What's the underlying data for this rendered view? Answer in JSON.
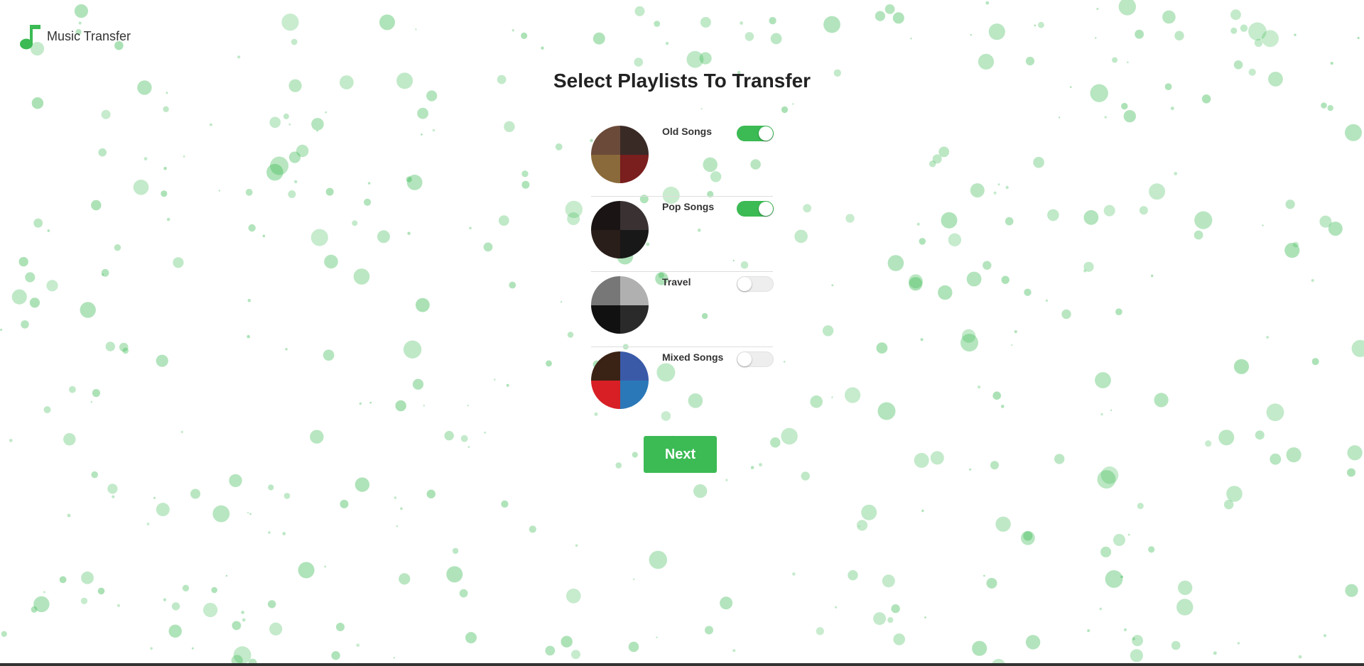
{
  "brand": {
    "name": "Music Transfer",
    "icon": "music-note-icon",
    "color": "#3cba54"
  },
  "page_title": "Select Playlists To Transfer",
  "playlists": [
    {
      "name": "Old Songs",
      "selected": true,
      "cover_colors": [
        "#6b4a3a",
        "#3a2a26",
        "#8a6a3a",
        "#7a1e1e"
      ]
    },
    {
      "name": "Pop Songs",
      "selected": true,
      "cover_colors": [
        "#1a1414",
        "#3a3232",
        "#2a1e1a",
        "#181818"
      ]
    },
    {
      "name": "Travel",
      "selected": false,
      "cover_colors": [
        "#777777",
        "#b0b0b0",
        "#111111",
        "#2a2a2a"
      ]
    },
    {
      "name": "Mixed Songs",
      "selected": false,
      "cover_colors": [
        "#3a2214",
        "#3a5aa8",
        "#d81f26",
        "#2a78b8"
      ]
    }
  ],
  "actions": {
    "next_label": "Next"
  },
  "colors": {
    "accent": "#3cba54",
    "bubble": "#3cba54",
    "toggle_off": "#eeeeee"
  }
}
